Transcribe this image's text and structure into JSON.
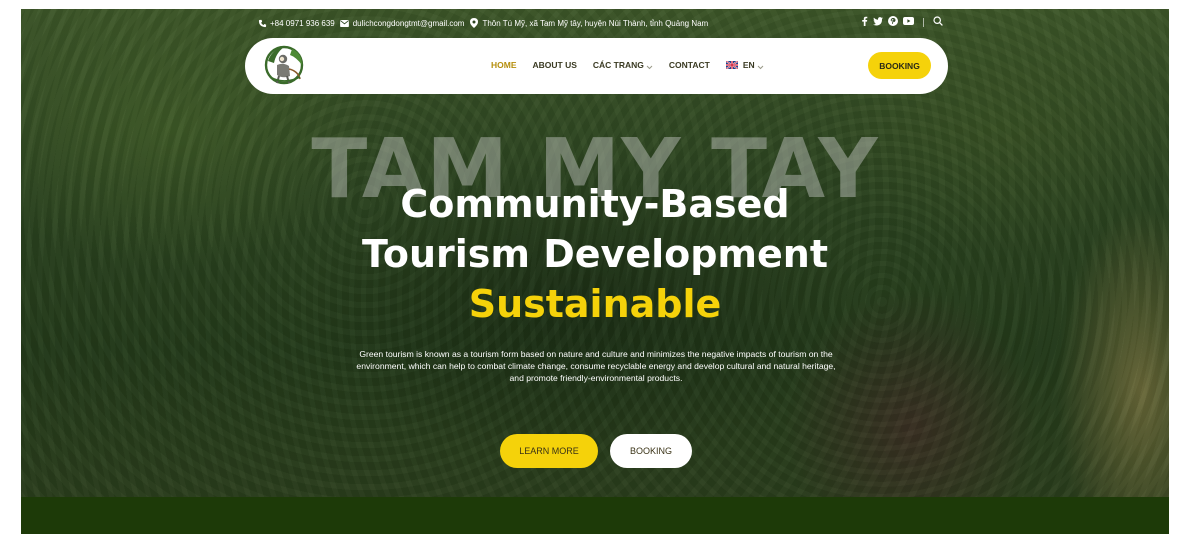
{
  "topbar": {
    "phone": "+84 0971 936 639",
    "email": "dulichcongdongtmt@gmail.com",
    "address": "Thôn Tú Mỹ, xã Tam Mỹ tây, huyện Núi Thành, tỉnh Quảng Nam",
    "social": [
      "facebook-icon",
      "twitter-icon",
      "pinterest-icon",
      "youtube-icon"
    ],
    "search_icon": "search-icon"
  },
  "nav": {
    "items": [
      {
        "label": "HOME",
        "active": true
      },
      {
        "label": "ABOUT US"
      },
      {
        "label": "CÁC TRANG",
        "dropdown": true
      },
      {
        "label": "CONTACT"
      },
      {
        "label": "EN",
        "dropdown": true,
        "flag": "uk-flag-icon"
      }
    ],
    "booking_label": "BOOKING"
  },
  "hero": {
    "background_word": "TAM MY TAY",
    "headline_line1": "Community-Based",
    "headline_line2": "Tourism Development",
    "headline_highlight": "Sustainable",
    "description": "Green tourism is known as a tourism form based on nature and culture and minimizes the negative impacts of tourism on the environment, which can help to combat climate change, consume recyclable energy and develop cultural and natural heritage, and promote friendly-environmental products.",
    "learn_more_label": "LEARN MORE",
    "booking_label": "BOOKING"
  },
  "colors": {
    "accent": "#f5d20a",
    "nav_active": "#b58e0c",
    "footer_band": "#1d3a08",
    "text_dark": "#3a3a22"
  }
}
